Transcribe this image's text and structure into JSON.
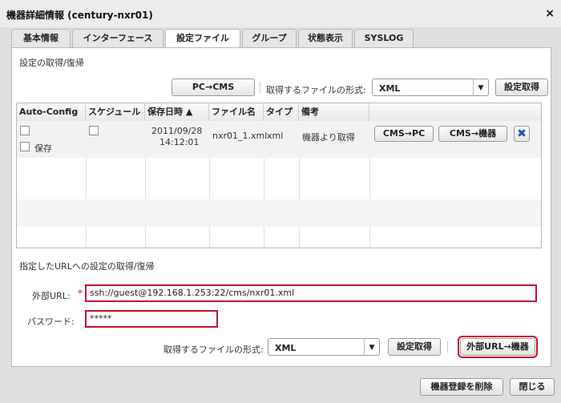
{
  "window": {
    "title": "機器詳細情報 (century-nxr01)",
    "close_label": "×"
  },
  "tabs": [
    "基本情報",
    "インターフェース",
    "設定ファイル",
    "グループ",
    "状態表示",
    "SYSLOG"
  ],
  "section1": {
    "label": "設定の取得/復帰",
    "pc_to_cms": "PC→CMS",
    "format_label": "取得するファイルの形式:",
    "format_value": "XML",
    "get_config": "設定取得"
  },
  "table": {
    "columns": [
      "Auto-Config",
      "スケジュール",
      "保存日時 ▲",
      "ファイル名",
      "タイプ",
      "備考"
    ],
    "rows": [
      {
        "save_label": "保存",
        "saved_date": "2011/09/28",
        "saved_time": "14:12:01",
        "filename": "nxr01_1.xml",
        "type": "xml",
        "note": "機器より取得",
        "cms_to_pc": "CMS→PC",
        "cms_to_device": "CMS→機器",
        "delete_label": "✖"
      }
    ]
  },
  "section2": {
    "label": "指定したURLへの設定の取得/復帰",
    "url_label": "外部URL:",
    "url_required": "*",
    "url_value": "ssh://guest@192.168.1.253:22/cms/nxr01.xml",
    "password_label": "パスワード:",
    "password_value": "*****",
    "format_label": "取得するファイルの形式:",
    "format_value": "XML",
    "get_config": "設定取得",
    "url_to_device": "外部URL→機器"
  },
  "footer": {
    "delete_device": "機器登録を削除",
    "close": "閉じる"
  },
  "colors": {
    "highlight": "#c8102e",
    "delete_icon": "#1e5aa8"
  }
}
